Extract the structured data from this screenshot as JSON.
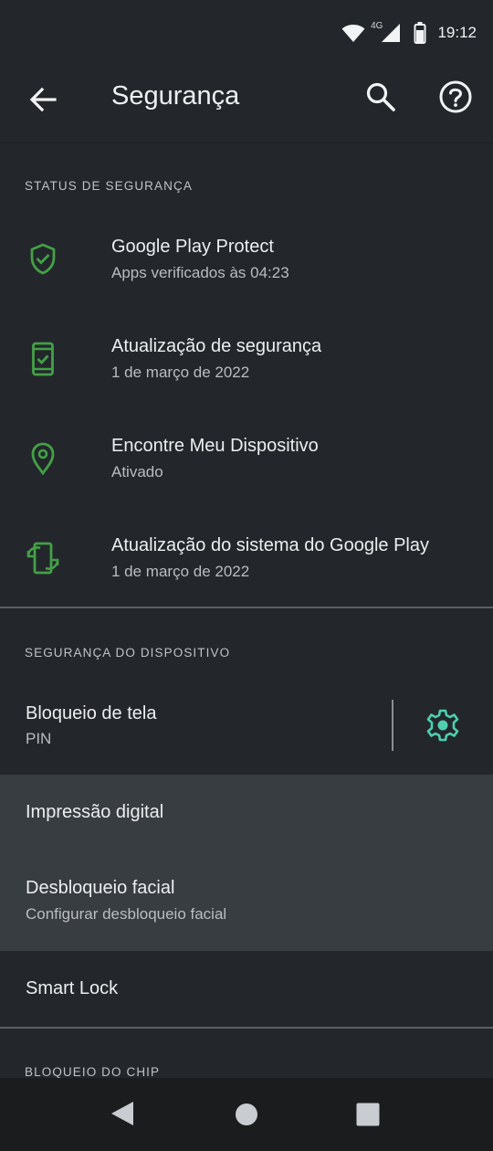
{
  "status_bar": {
    "time": "19:12",
    "network": "4G"
  },
  "app_bar": {
    "title": "Segurança"
  },
  "sections": {
    "status": {
      "header": "STATUS DE SEGURANÇA",
      "items": [
        {
          "title": "Google Play Protect",
          "subtitle": "Apps verificados às 04:23",
          "icon": "shield-check-icon"
        },
        {
          "title": "Atualização de segurança",
          "subtitle": "1 de março de 2022",
          "icon": "phone-check-icon"
        },
        {
          "title": "Encontre Meu Dispositivo",
          "subtitle": "Ativado",
          "icon": "location-pin-icon"
        },
        {
          "title": "Atualização do sistema do Google Play",
          "subtitle": "1 de março de 2022",
          "icon": "phone-sync-icon"
        }
      ]
    },
    "device": {
      "header": "SEGURANÇA DO DISPOSITIVO",
      "items": [
        {
          "title": "Bloqueio de tela",
          "subtitle": "PIN"
        },
        {
          "title": "Impressão digital"
        },
        {
          "title": "Desbloqueio facial",
          "subtitle": "Configurar desbloqueio facial"
        },
        {
          "title": "Smart Lock"
        }
      ]
    },
    "chip": {
      "header": "BLOQUEIO DO CHIP"
    }
  },
  "colors": {
    "accent_green": "#43a047",
    "accent_teal": "#4dd0b0",
    "background": "#23272b",
    "highlight": "#383d42"
  }
}
